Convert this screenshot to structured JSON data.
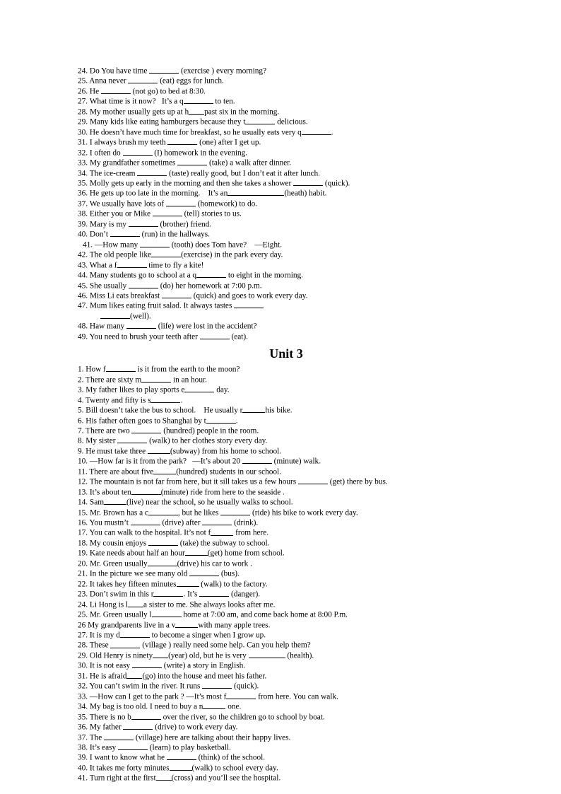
{
  "document": {
    "type": "worksheet",
    "page_background": "#ffffff",
    "text_color": "#000000"
  },
  "section_one": {
    "items": [
      {
        "n": "24.",
        "pre": "Do You have time ",
        "blank": "md",
        "post": " (exercise ) every morning?"
      },
      {
        "n": "25.",
        "pre": "Anna never ",
        "blank": "md",
        "post": " (eat) eggs for lunch."
      },
      {
        "n": "26.",
        "pre": "He ",
        "blank": "md",
        "post": " (not go) to bed at 8:30."
      },
      {
        "n": "27.",
        "pre": "What time is it now?   It’s a q",
        "blank": "md",
        "post": " to ten."
      },
      {
        "n": "28.",
        "pre": "My mother usually gets up at h",
        "blank": "xs",
        "post": "past six in the morning."
      },
      {
        "n": "29.",
        "pre": "Many kids like eating hamburgers because they t",
        "blank": "md",
        "post": " delicious."
      },
      {
        "n": "30.",
        "pre": "He doesn’t have much time for breakfast, so he usually eats very q",
        "blank": "md",
        "post": "."
      },
      {
        "n": "31.",
        "pre": "I always brush my teeth ",
        "blank": "md",
        "post": " (one) after I get up."
      },
      {
        "n": "32.",
        "pre": "I often do ",
        "blank": "md",
        "post": " (I) homework in the evening."
      },
      {
        "n": "33.",
        "pre": "My grandfather sometimes ",
        "blank": "md",
        "post": " (take) a walk after dinner."
      },
      {
        "n": "34.",
        "pre": "The ice-cream ",
        "blank": "md",
        "post": " (taste) really good, but I don’t eat it after lunch."
      },
      {
        "n": "35.",
        "pre": "Molly gets up early in the morning and then she takes a shower ",
        "blank": "md",
        "post": " (quick)."
      },
      {
        "n": "36.",
        "pre": "He gets up too late in the morning.    It’s an",
        "blank": "xxl",
        "post": "(heath) habit."
      },
      {
        "n": "37.",
        "pre": "We usually have lots of ",
        "blank": "md",
        "post": " (homework) to do."
      },
      {
        "n": "38.",
        "pre": "Either you or Mike ",
        "blank": "md",
        "post": " (tell) stories to us."
      },
      {
        "n": "39.",
        "pre": "Mary is my ",
        "blank": "md",
        "post": " (brother) friend."
      },
      {
        "n": "40.",
        "pre": "Don’t ",
        "blank": "md",
        "post": " (run) in the hallways."
      },
      {
        "n": "41.",
        "pre": "—How many ",
        "blank": "md",
        "post": " (tooth) does Tom have?    —Eight.",
        "indent": true
      },
      {
        "n": "42.",
        "pre": "The old people like",
        "blank": "md",
        "post": "(exercise) in the park every day."
      },
      {
        "n": "43.",
        "pre": "What a f",
        "blank": "md",
        "post": " time to fly a kite!"
      },
      {
        "n": "44.",
        "pre": "Many students go to school at a q",
        "blank": "md",
        "post": " to eight in the morning."
      },
      {
        "n": "45.",
        "pre": "She usually ",
        "blank": "md",
        "post": " (do) her homework at 7:00 p.m."
      },
      {
        "n": "46.",
        "pre": "Miss Li eats breakfast ",
        "blank": "md",
        "post": " (quick) and goes to work every day."
      },
      {
        "n": "47.",
        "pre": "Mum likes eating fruit salad. It always tastes ",
        "blank": "md",
        "post": ""
      },
      {
        "n": "",
        "pre": "",
        "blank": "md",
        "post": "(well).",
        "continuation": true
      },
      {
        "n": "48.",
        "pre": "Haw many ",
        "blank": "md",
        "post": " (life) were lost in the accident?"
      },
      {
        "n": "49.",
        "pre": "You need to brush your teeth after ",
        "blank": "md",
        "post": " (eat)."
      }
    ]
  },
  "unit_heading": "Unit 3",
  "section_two": {
    "items": [
      {
        "n": "1.",
        "pre": "How f",
        "blank": "md",
        "post": " is it from the earth to the moon?"
      },
      {
        "n": "2.",
        "pre": "There are sixty m",
        "blank": "md",
        "post": " in an hour."
      },
      {
        "n": "3.",
        "pre": "My father likes to play sports e",
        "blank": "md",
        "post": " day."
      },
      {
        "n": "4.",
        "pre": "Twenty and fifty is s",
        "blank": "md",
        "post": "."
      },
      {
        "n": "5.",
        "pre": "Bill doesn’t take the bus to school.    He usually r",
        "blank": "sm",
        "post": "his bike."
      },
      {
        "n": "6.",
        "pre": "His father often goes to Shanghai by t",
        "blank": "md",
        "post": "."
      },
      {
        "n": "7.",
        "pre": "There are two ",
        "blank": "md",
        "post": " (hundred) people in the room."
      },
      {
        "n": "8.",
        "pre": "My sister ",
        "blank": "md",
        "post": " (walk) to her clothes story every day."
      },
      {
        "n": "9.",
        "pre": "He must take three ",
        "blank": "sm",
        "post": "(subway) from his home to school."
      },
      {
        "n": "10.",
        "pre": "—How far is it from the park?   —It’s about 20 ",
        "blank": "md",
        "post": " (minute) walk."
      },
      {
        "n": "11.",
        "pre": "There are about five",
        "blank": "sm",
        "post": "(hundred) students in our school."
      },
      {
        "n": "12.",
        "pre": "The mountain is not far from here, but it sill takes us a few hours ",
        "blank": "md",
        "post": " (get) there by bus."
      },
      {
        "n": "13.",
        "pre": "It’s about ten",
        "blank": "md",
        "post": "(minute) ride from here to the seaside ."
      },
      {
        "n": "14.",
        "pre": "Sam",
        "blank": "sm",
        "post": "(live) near the school, so he usually walks to school."
      },
      {
        "n": "15.",
        "pre": "Mr. Brown has a c",
        "blank": "md",
        "post": ", but he likes ",
        "blank2": "md",
        "post2": " (ride) his bike to work every day."
      },
      {
        "n": "16.",
        "pre": "You mustn’t ",
        "blank": "md",
        "post": " (drive) after ",
        "blank2": "md",
        "post2": " (drink)."
      },
      {
        "n": "17.",
        "pre": "You can walk to the hospital. It’s not f",
        "blank": "sm",
        "post": " from here."
      },
      {
        "n": "18.",
        "pre": "My cousin enjoys ",
        "blank": "md",
        "post": " (take) the subway to school."
      },
      {
        "n": "19.",
        "pre": "Kate needs about half an hour",
        "blank": "sm",
        "post": "(get) home from school."
      },
      {
        "n": "20.",
        "pre": "Mr. Green usually",
        "blank": "md",
        "post": "(drive) his car to work ."
      },
      {
        "n": "21.",
        "pre": "In the picture we see many old ",
        "blank": "md",
        "post": " (bus)."
      },
      {
        "n": "22.",
        "pre": "It takes hey fifteen minutes",
        "blank": "sm",
        "post": " (walk) to the factory."
      },
      {
        "n": "23.",
        "pre": "Don’t swim in this r",
        "blank": "md",
        "post": ". It’s ",
        "blank2": "md",
        "post2": " (danger)."
      },
      {
        "n": "24.",
        "pre": "Li Hong is l",
        "blank": "xs",
        "post": "a sister to me. She always looks after me."
      },
      {
        "n": "25.",
        "pre": "Mr. Green usually l",
        "blank": "md",
        "post": " home at 7:00 am, and come back home at 8:00 P.m."
      },
      {
        "n": "26",
        "pre": "My grandparents live in a v",
        "blank": "sm",
        "post": "with many apple trees."
      },
      {
        "n": "27.",
        "pre": "It is my d",
        "blank": "md",
        "post": " to become a singer when I grow up."
      },
      {
        "n": "28.",
        "pre": "These ",
        "blank": "md",
        "post": " (village ) really need some help. Can you help them?"
      },
      {
        "n": "29.",
        "pre": "Old Henry is ninety",
        "blank": "xs",
        "post": "(year) old, but he is very ",
        "blank2": "lg",
        "post2": " (health)."
      },
      {
        "n": "30.",
        "pre": "It is not easy ",
        "blank": "md",
        "post": " (write) a story in English."
      },
      {
        "n": "31.",
        "pre": "He is afraid",
        "blank": "xs",
        "post": "(go) into the house and meet his father."
      },
      {
        "n": "32.",
        "pre": "You can’t swim in the river. It runs ",
        "blank": "md",
        "post": " (quick)."
      },
      {
        "n": "33.",
        "pre": "—How can I get to the park ? —It’s most f",
        "blank": "md",
        "post": " from here. You can walk."
      },
      {
        "n": "34.",
        "pre": "My bag is too old. I need to buy a n",
        "blank": "sm",
        "post": " one."
      },
      {
        "n": "35.",
        "pre": "There is no b",
        "blank": "md",
        "post": " over the river, so the children go to school by boat."
      },
      {
        "n": "36.",
        "pre": "My father ",
        "blank": "md",
        "post": " (drive) to work every day."
      },
      {
        "n": "37.",
        "pre": "The ",
        "blank": "md",
        "post": " (village) here are talking about their happy lives."
      },
      {
        "n": "38.",
        "pre": "It’s easy ",
        "blank": "md",
        "post": " (learn) to play basketball."
      },
      {
        "n": "39.",
        "pre": "I want to know what he ",
        "blank": "md",
        "post": " (think) of the school."
      },
      {
        "n": "40.",
        "pre": "It takes me forty minutes",
        "blank": "sm",
        "post": "(walk) to school every day."
      },
      {
        "n": "41.",
        "pre": "Turn right at the first",
        "blank": "xs",
        "post": "(cross) and you’ll see the hospital."
      }
    ]
  }
}
